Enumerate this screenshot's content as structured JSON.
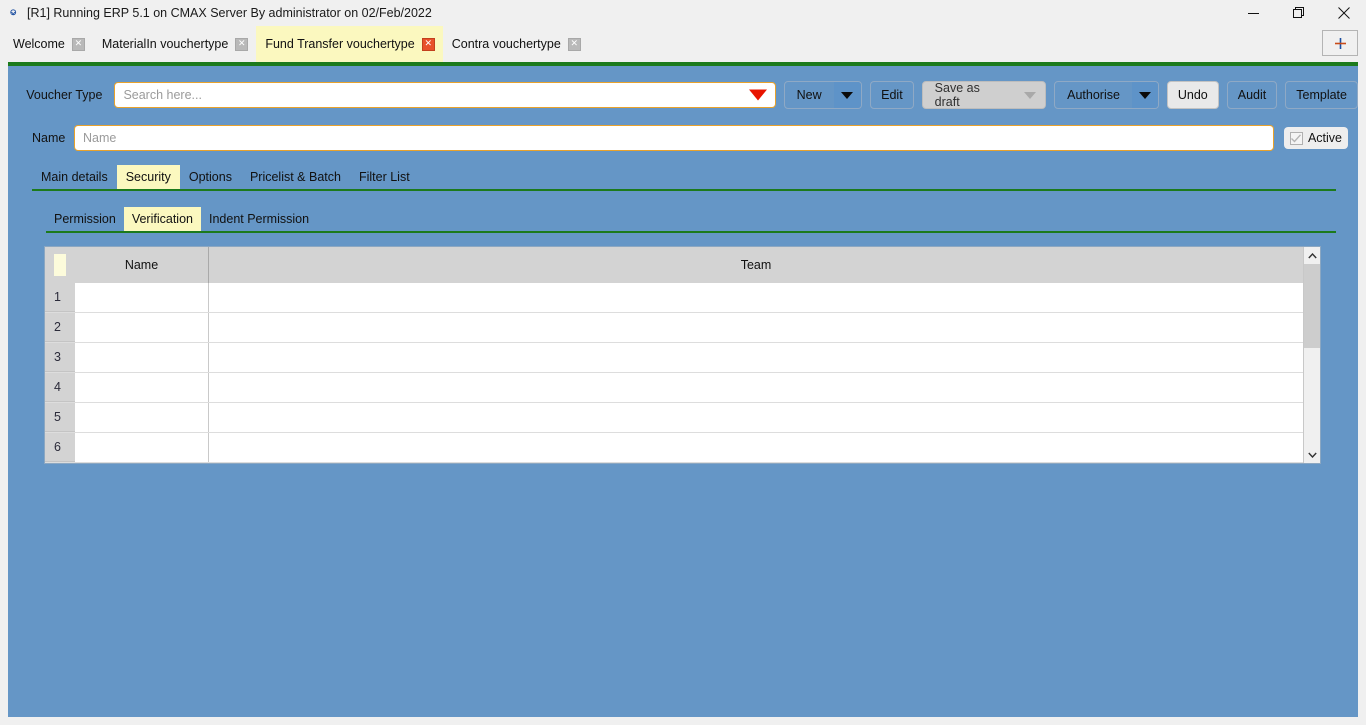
{
  "window": {
    "icon": "app-icon",
    "title": "[R1] Running ERP 5.1 on CMAX Server By administrator on 02/Feb/2022",
    "controls": {
      "minimize": "minimize-icon",
      "restore": "restore-icon",
      "close": "close-icon"
    }
  },
  "tabbar": {
    "tabs": [
      {
        "label": "Welcome",
        "active": false,
        "close": "close-icon"
      },
      {
        "label": "MaterialIn vouchertype",
        "active": false,
        "close": "close-icon"
      },
      {
        "label": "Fund Transfer vouchertype",
        "active": true,
        "close": "close-icon"
      },
      {
        "label": "Contra vouchertype",
        "active": false,
        "close": "close-icon"
      }
    ],
    "add_tab_label": "+",
    "add_tab_icon": "plus-icon"
  },
  "toolbar": {
    "voucher_type_label": "Voucher Type",
    "search_placeholder": "Search here...",
    "search_value": "",
    "search_dropdown_icon": "caret-down-icon",
    "new_label": "New",
    "new_dropdown_icon": "caret-down-icon",
    "edit_label": "Edit",
    "save_as_draft_label": "Save as draft",
    "save_as_draft_dropdown_icon": "caret-down-icon",
    "authorise_label": "Authorise",
    "authorise_dropdown_icon": "caret-down-icon",
    "undo_label": "Undo",
    "audit_label": "Audit",
    "template_label": "Template"
  },
  "form": {
    "name_label": "Name",
    "name_placeholder": "Name",
    "name_value": "",
    "active_label": "Active",
    "active_checked": true,
    "active_check_icon": "check-icon"
  },
  "main_tabs": [
    {
      "label": "Main details",
      "active": false
    },
    {
      "label": "Security",
      "active": true
    },
    {
      "label": "Options",
      "active": false
    },
    {
      "label": "Pricelist & Batch",
      "active": false
    },
    {
      "label": "Filter List",
      "active": false
    }
  ],
  "sub_tabs": [
    {
      "label": "Permission",
      "active": false
    },
    {
      "label": "Verification",
      "active": true
    },
    {
      "label": "Indent Permission",
      "active": false
    }
  ],
  "grid": {
    "columns": [
      "",
      "Name",
      "Team"
    ],
    "rows": [
      {
        "num": "1",
        "name": "",
        "team": ""
      },
      {
        "num": "2",
        "name": "",
        "team": ""
      },
      {
        "num": "3",
        "name": "",
        "team": ""
      },
      {
        "num": "4",
        "name": "",
        "team": ""
      },
      {
        "num": "5",
        "name": "",
        "team": ""
      },
      {
        "num": "6",
        "name": "",
        "team": ""
      }
    ],
    "scrollbar": {
      "up_icon": "chevron-up-icon",
      "down_icon": "chevron-down-icon",
      "thumb_fraction": 0.46
    }
  },
  "colors": {
    "workspace_blue": "#6596c6",
    "active_tab_yellow": "#fbf8bf",
    "accent_green": "#1c7a1c",
    "field_border_orange": "#e8a22c",
    "close_red": "#e8512a",
    "dropdown_red": "#e81400"
  }
}
